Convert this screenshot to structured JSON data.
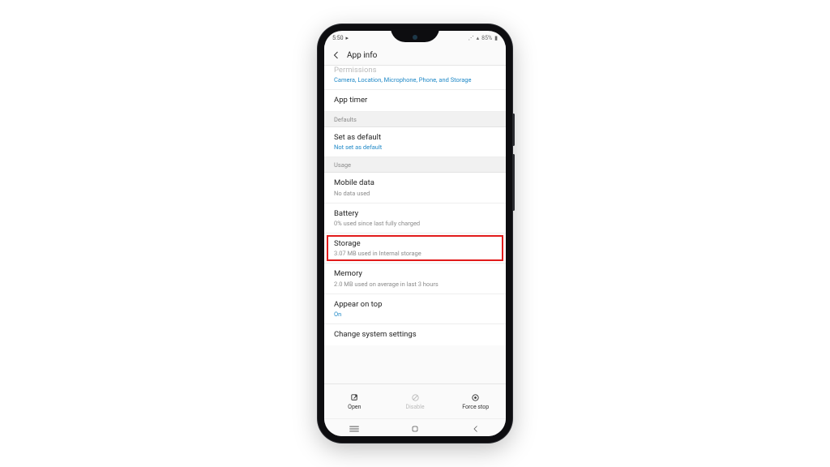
{
  "status": {
    "time": "5:50",
    "battery_pct": "85%"
  },
  "header": {
    "title": "App info"
  },
  "rows": {
    "permissions": {
      "label": "Permissions",
      "sub": "Camera, Location, Microphone, Phone, and Storage"
    },
    "app_timer": {
      "label": "App timer"
    },
    "sec_defaults": "Defaults",
    "set_default": {
      "label": "Set as default",
      "sub": "Not set as default"
    },
    "sec_usage": "Usage",
    "mobile_data": {
      "label": "Mobile data",
      "sub": "No data used"
    },
    "battery": {
      "label": "Battery",
      "sub": "0% used since last fully charged"
    },
    "storage": {
      "label": "Storage",
      "sub": "3.07 MB used in Internal storage"
    },
    "memory": {
      "label": "Memory",
      "sub": "2.0 MB used on average in last 3 hours"
    },
    "appear_on_top": {
      "label": "Appear on top",
      "sub": "On"
    },
    "change_sys": {
      "label": "Change system settings"
    }
  },
  "bottom": {
    "open": "Open",
    "disable": "Disable",
    "force_stop": "Force stop"
  }
}
